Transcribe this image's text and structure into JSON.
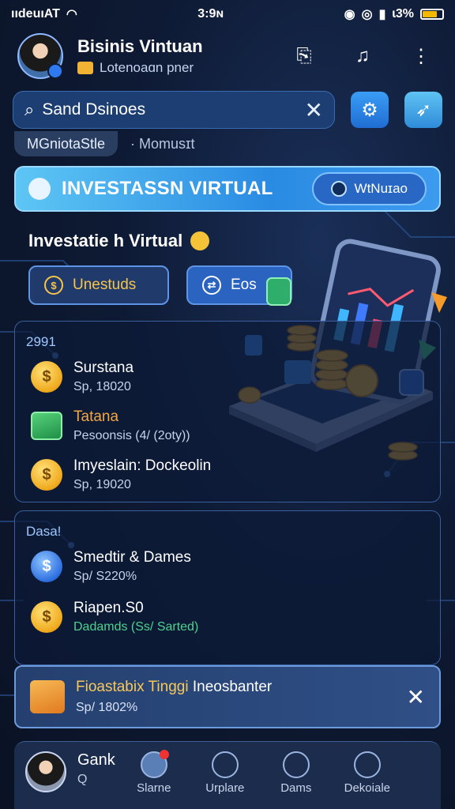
{
  "status_bar": {
    "carrier": "ııdeuıAT",
    "time": "3:9ɴ",
    "battery": "ɩ3%"
  },
  "header": {
    "title": "Bisinis Vintuan",
    "subtitle": "Lotenoaɑn pner"
  },
  "search": {
    "placeholder": "Sand Dsinoes"
  },
  "chips": [
    "MGniotaStle",
    "Momusɪt"
  ],
  "invest_banner": {
    "title": "INVESTASSN VIRTUAL",
    "button": "WtNuɪao"
  },
  "invest_panel": {
    "heading": "Investatie h Virtual",
    "button_1": "Unestuds",
    "button_2": "Eos"
  },
  "list_1": {
    "label": "2991",
    "items": [
      {
        "title": "Surstana",
        "subtitle": "Sp, 18020"
      },
      {
        "title": "Tatana",
        "subtitle": "Pesoonsis (4/ (2oty))"
      },
      {
        "title": "Imyeslain: Dockeolin",
        "subtitle": "Sp, 19020"
      }
    ]
  },
  "list_2": {
    "label": "Dasa!",
    "items": [
      {
        "title": "Smedtir & Dames",
        "subtitle": "Sp/ S220%"
      },
      {
        "title": "Riapen.S0",
        "subtitle": "Dadamds (Ss/ Sarted)"
      }
    ]
  },
  "notice": {
    "title": "Fioastabix Tinggi",
    "title_rest": "Ineosbanter",
    "subtitle": "Sp/ 1802%"
  },
  "bottom_nav": {
    "user_name": "Gank",
    "user_sub": "Q",
    "items": [
      "Slarne",
      "Urplare",
      "Dams",
      "Dekoiale"
    ]
  }
}
